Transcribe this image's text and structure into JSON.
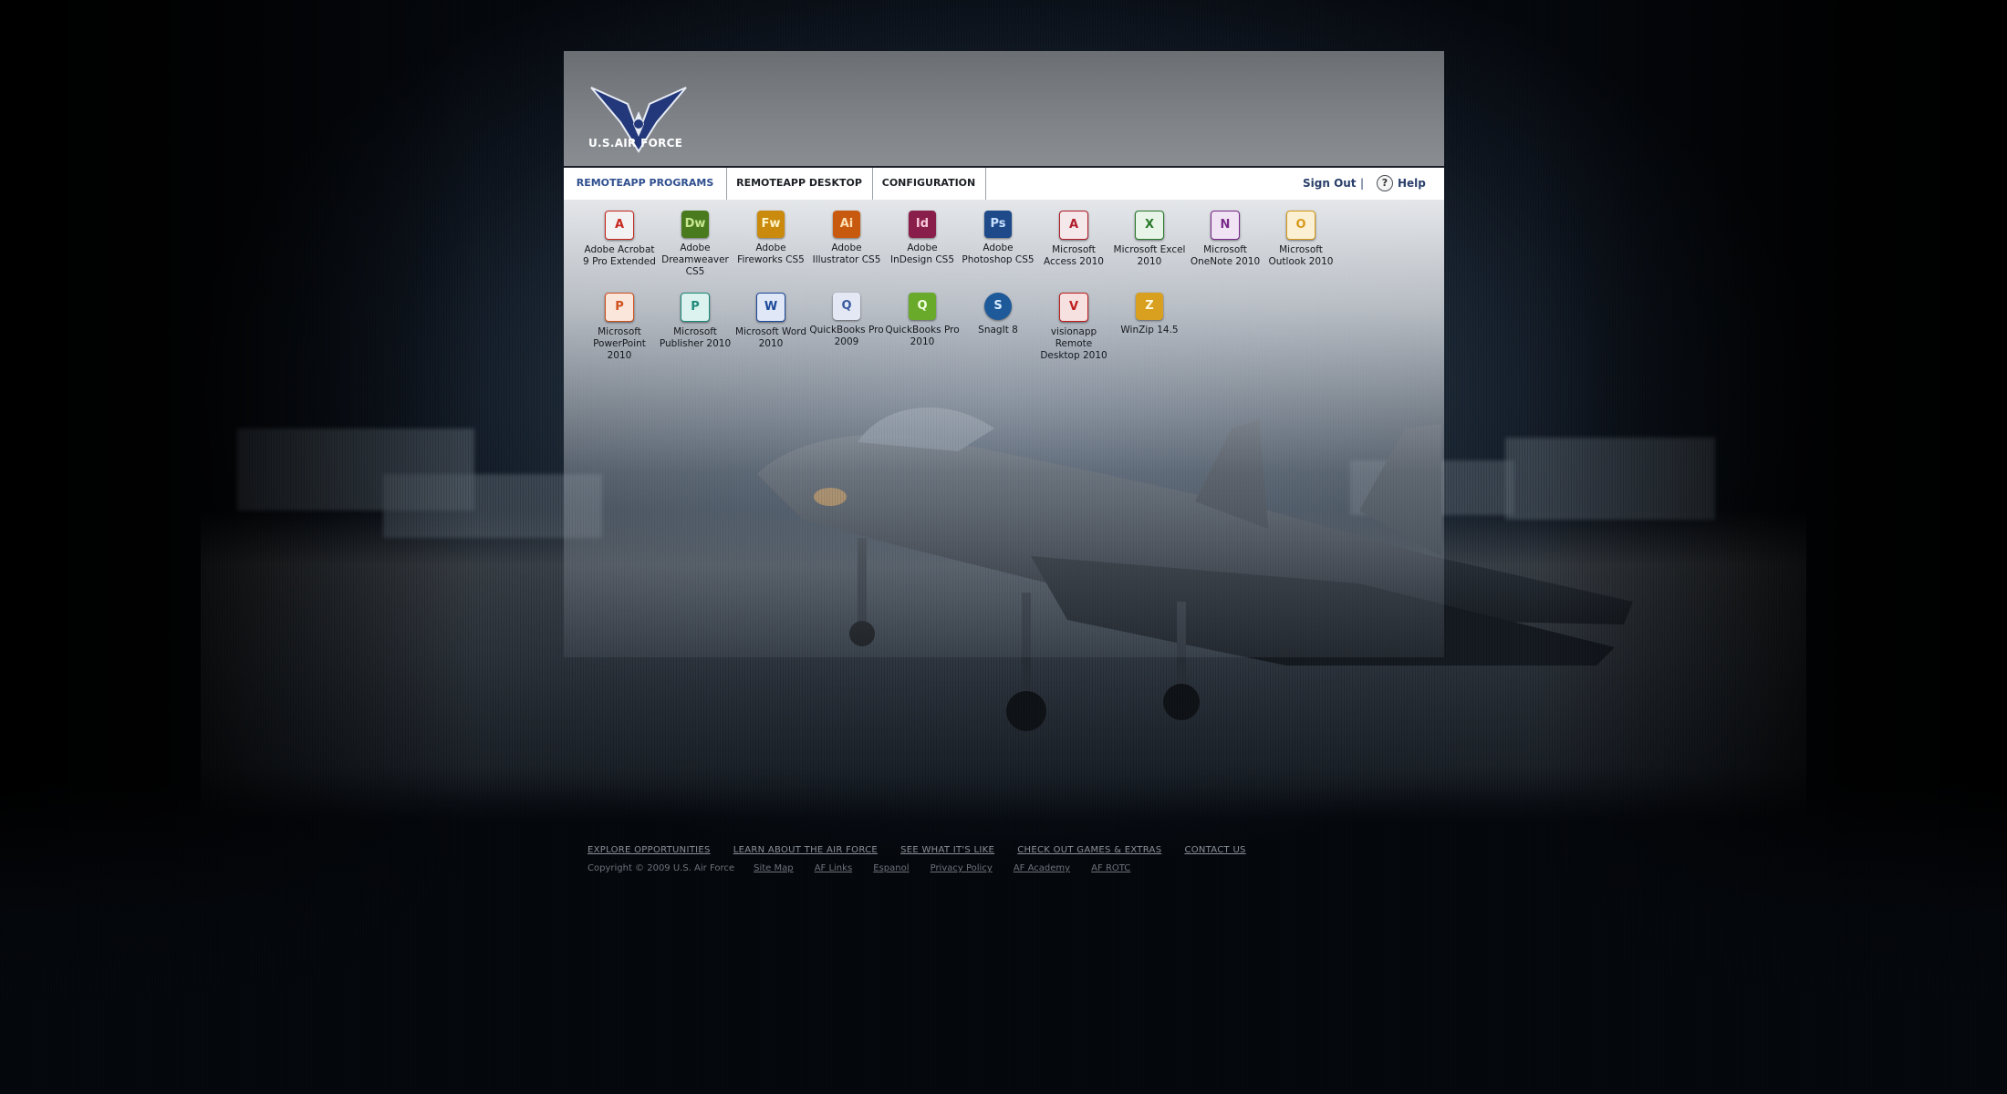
{
  "header": {
    "logo_text": "U.S.AIR FORCE",
    "logo_icon": "air-force-wings-icon"
  },
  "nav": {
    "tabs": [
      {
        "label": "REMOTEAPP PROGRAMS",
        "active": true
      },
      {
        "label": "REMOTEAPP DESKTOP",
        "active": false
      },
      {
        "label": "CONFIGURATION",
        "active": false
      }
    ],
    "sign_out": "Sign Out",
    "separator": "|",
    "help_icon_glyph": "?",
    "help": "Help"
  },
  "apps": [
    {
      "label": "Adobe Acrobat 9 Pro Extended",
      "glyph": "A",
      "color": "#c8281e",
      "icon": "acrobat-icon"
    },
    {
      "label": "Adobe Dreamweaver CS5",
      "glyph": "Dw",
      "color": "#4a7a1e",
      "icon": "dreamweaver-icon"
    },
    {
      "label": "Adobe Fireworks CS5",
      "glyph": "Fw",
      "color": "#c98a0e",
      "icon": "fireworks-icon"
    },
    {
      "label": "Adobe Illustrator CS5",
      "glyph": "Ai",
      "color": "#c85a10",
      "icon": "illustrator-icon"
    },
    {
      "label": "Adobe InDesign CS5",
      "glyph": "Id",
      "color": "#8a1e4a",
      "icon": "indesign-icon"
    },
    {
      "label": "Adobe Photoshop CS5",
      "glyph": "Ps",
      "color": "#1e4a8a",
      "icon": "photoshop-icon"
    },
    {
      "label": "Microsoft Access 2010",
      "glyph": "A",
      "color": "#b01e2a",
      "icon": "access-icon"
    },
    {
      "label": "Microsoft Excel 2010",
      "glyph": "X",
      "color": "#2a7a2a",
      "icon": "excel-icon"
    },
    {
      "label": "Microsoft OneNote 2010",
      "glyph": "N",
      "color": "#7a2a8a",
      "icon": "onenote-icon"
    },
    {
      "label": "Microsoft Outlook 2010",
      "glyph": "O",
      "color": "#d89a1a",
      "icon": "outlook-icon"
    },
    {
      "label": "Microsoft PowerPoint 2010",
      "glyph": "P",
      "color": "#d0501e",
      "icon": "powerpoint-icon"
    },
    {
      "label": "Microsoft Publisher 2010",
      "glyph": "P",
      "color": "#1e8a7a",
      "icon": "publisher-icon"
    },
    {
      "label": "Microsoft Word 2010",
      "glyph": "W",
      "color": "#1e4a9a",
      "icon": "word-icon"
    },
    {
      "label": "QuickBooks Pro 2009",
      "glyph": "Q",
      "color": "#3a5aa0",
      "icon": "quickbooks-2009-icon"
    },
    {
      "label": "QuickBooks Pro 2010",
      "glyph": "Q",
      "color": "#6aaa2a",
      "icon": "quickbooks-2010-icon"
    },
    {
      "label": "SnagIt 8",
      "glyph": "S",
      "color": "#1e5a9a",
      "icon": "snagit-icon"
    },
    {
      "label": "visionapp Remote Desktop 2010",
      "glyph": "V",
      "color": "#c01e1e",
      "icon": "visionapp-icon"
    },
    {
      "label": "WinZip 14.5",
      "glyph": "Z",
      "color": "#d8a01e",
      "icon": "winzip-icon"
    }
  ],
  "footer": {
    "links": [
      "EXPLORE  OPPORTUNITIES",
      "LEARN ABOUT THE AIR FORCE",
      "SEE WHAT IT'S LIKE",
      "CHECK OUT GAMES & EXTRAS",
      "CONTACT US"
    ],
    "copyright": "Copyright © 2009 U.S.  Air Force",
    "small_links": [
      "Site Map",
      "AF Links",
      "Espanol",
      "Privacy Policy",
      "AF Academy",
      "AF ROTC"
    ]
  }
}
